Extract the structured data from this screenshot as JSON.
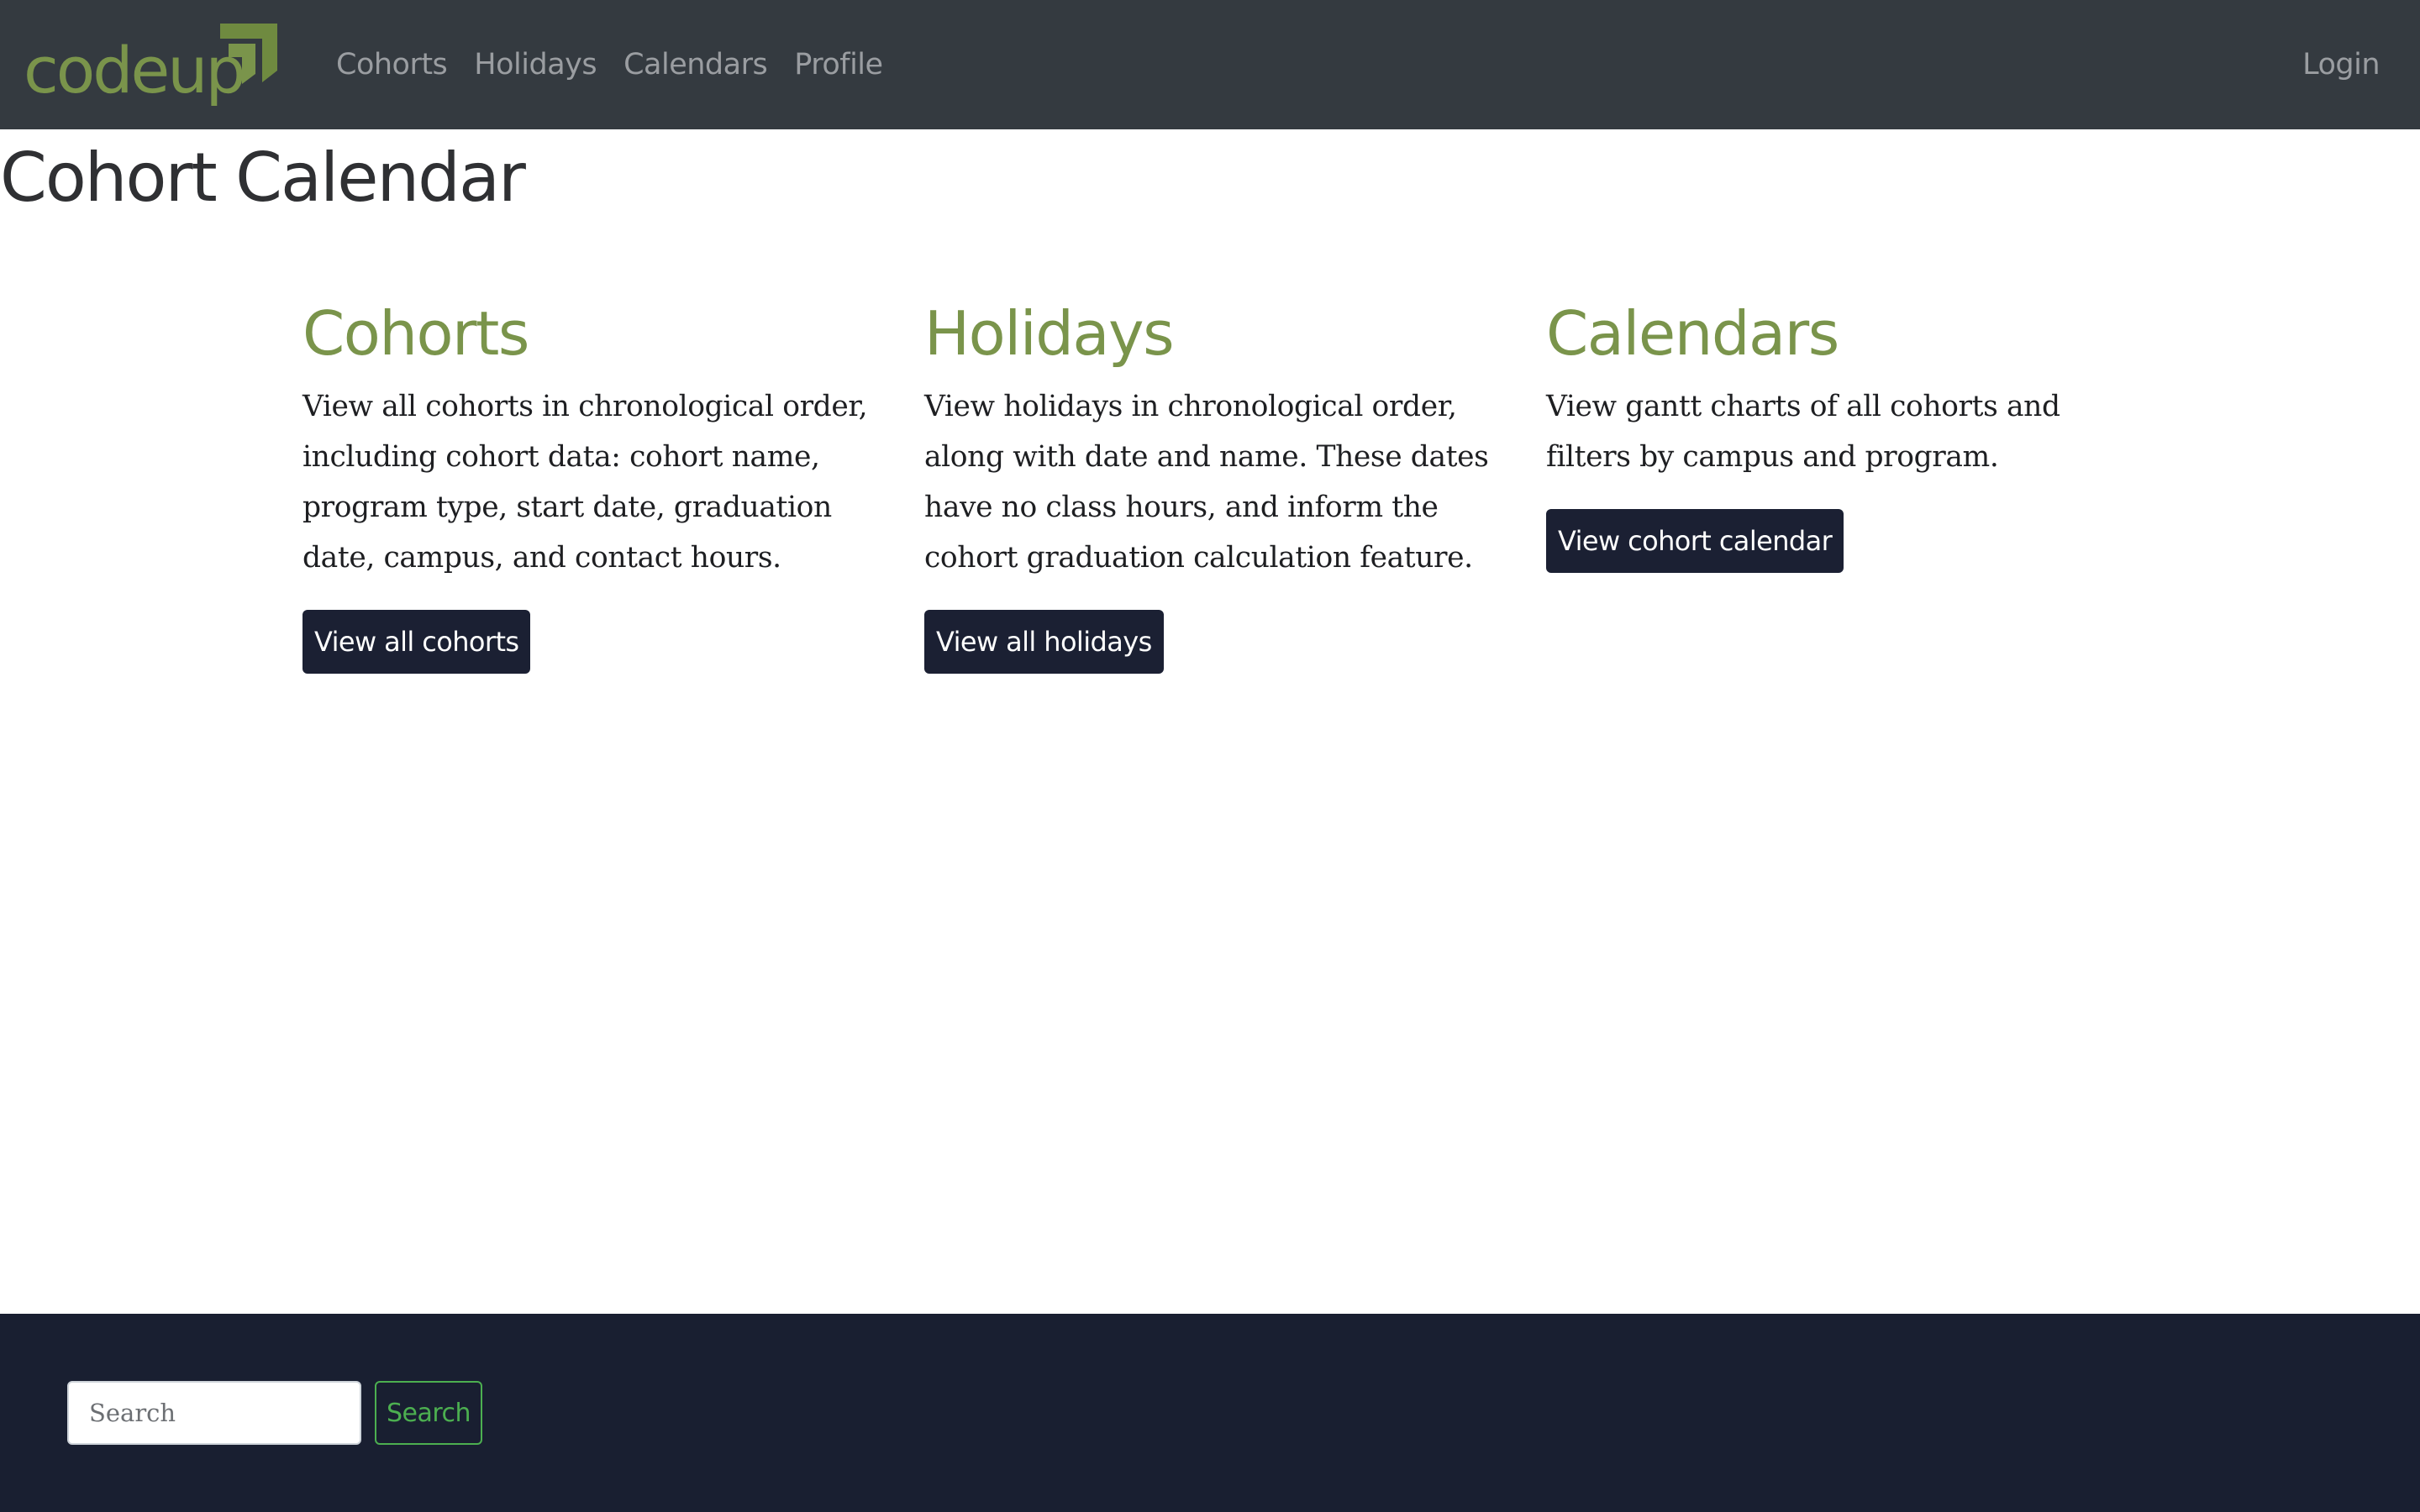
{
  "colors": {
    "navbar_bg": "#343a40",
    "nav_link": "#9a9da1",
    "brand_green": "#7a944b",
    "heading_green": "#7a944b",
    "button_bg": "#1b2033",
    "footer_bg": "#191f31",
    "search_button_accent": "#4caf50"
  },
  "navbar": {
    "brand": "codeup",
    "links": [
      "Cohorts",
      "Holidays",
      "Calendars",
      "Profile"
    ],
    "login": "Login"
  },
  "page": {
    "title": "Cohort Calendar"
  },
  "cards": [
    {
      "title": "Cohorts",
      "text": "View all cohorts in chronological order, including cohort data: cohort name, program type, start date, graduation date, campus, and contact hours.",
      "button": "View all cohorts"
    },
    {
      "title": "Holidays",
      "text": "View holidays in chronological order, along with date and name. These dates have no class hours, and inform the cohort graduation calculation feature.",
      "button": "View all holidays"
    },
    {
      "title": "Calendars",
      "text": "View gantt charts of all cohorts and filters by campus and program.",
      "button": "View cohort calendar"
    }
  ],
  "footer": {
    "search_placeholder": "Search",
    "search_button": "Search"
  }
}
